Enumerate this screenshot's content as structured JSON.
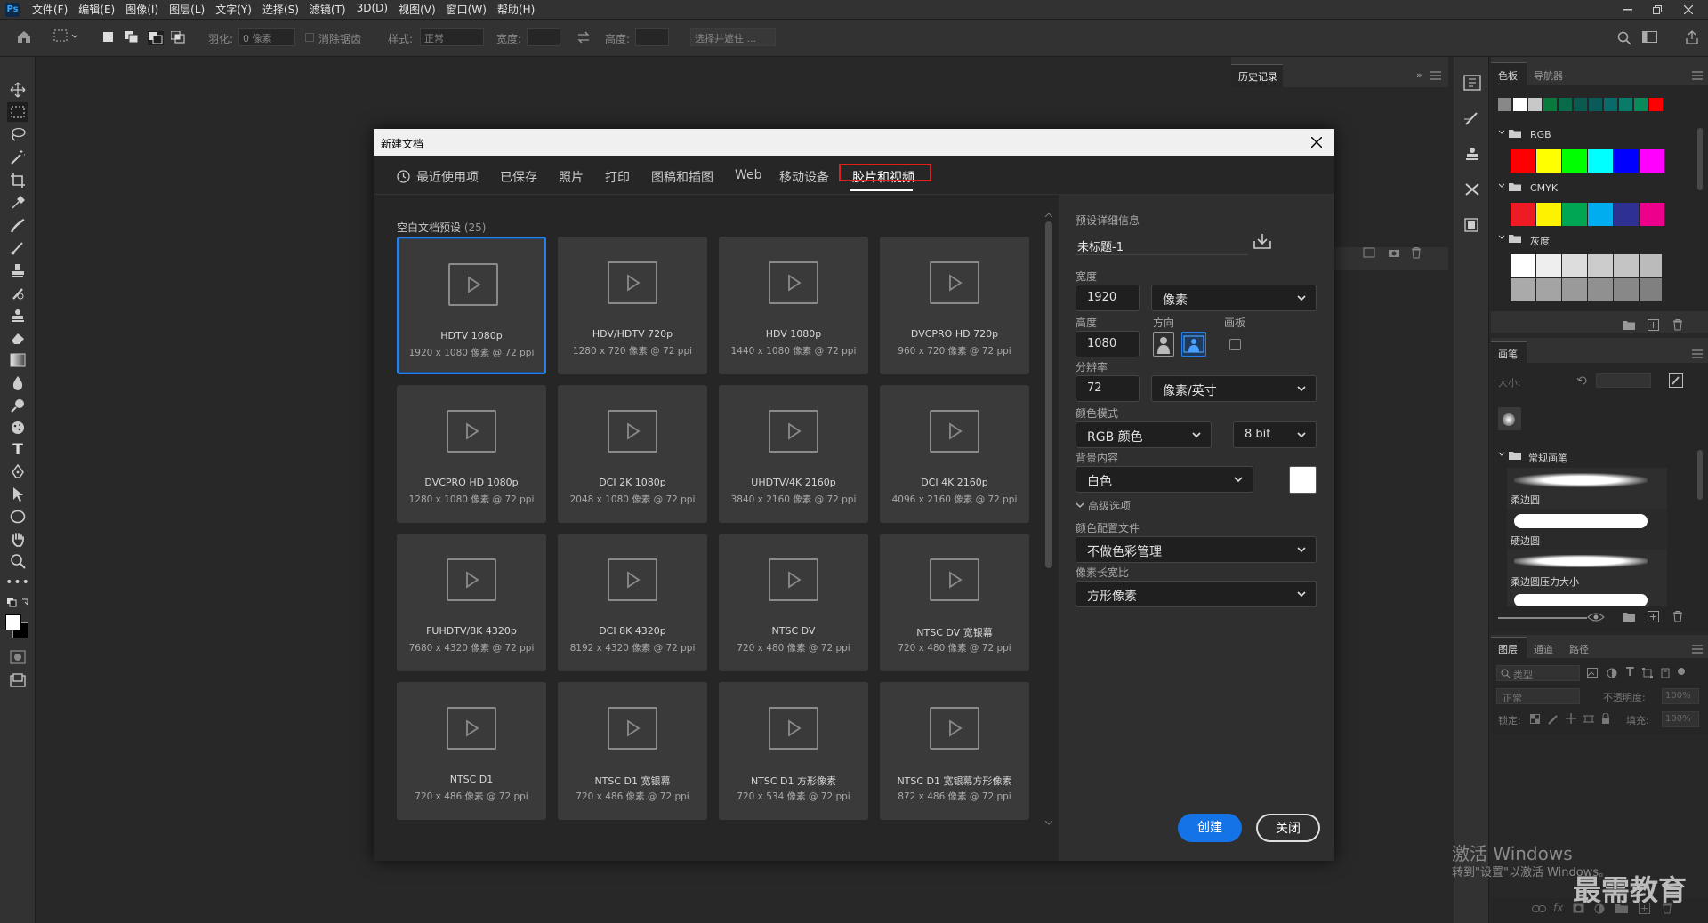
{
  "menu": {
    "app_icon": "Ps",
    "items": [
      "文件(F)",
      "编辑(E)",
      "图像(I)",
      "图层(L)",
      "文字(Y)",
      "选择(S)",
      "滤镜(T)",
      "3D(D)",
      "视图(V)",
      "窗口(W)",
      "帮助(H)"
    ]
  },
  "options": {
    "feather_label": "羽化:",
    "feather_value": "0 像素",
    "antialias_label": "消除锯齿",
    "style_label": "样式:",
    "style_value": "正常",
    "width_label": "宽度:",
    "height_label": "高度:",
    "select_mask_label": "选择并遮住 ..."
  },
  "history_panel": {
    "title": "历史记录"
  },
  "swatches_panel": {
    "tabs": [
      "色板",
      "导航器"
    ],
    "groups": [
      "RGB",
      "CMYK",
      "灰度"
    ],
    "recent_colors": [
      "#888888",
      "#ffffff",
      "#c8c8c8",
      "#0a7a3c",
      "#0a6a4a",
      "#0a5a50",
      "#0a5a5a",
      "#0a6a6a",
      "#0a7a6a",
      "#0a8a5a",
      "#ff0000"
    ],
    "rgb_colors": [
      "#ff0000",
      "#ffff00",
      "#00ff00",
      "#00ffff",
      "#0000ff",
      "#ff00ff"
    ],
    "cmyk_colors": [
      "#ed1c24",
      "#fff200",
      "#00a651",
      "#00aeef",
      "#2e3192",
      "#ec008c"
    ],
    "gray_colors": [
      "#ffffff",
      "#eeeeee",
      "#dddddd",
      "#cccccc",
      "#c4c4c4",
      "#bbbbbb",
      "#aaaaaa",
      "#a4a4a4",
      "#9a9a9a",
      "#909090",
      "#888888",
      "#808080"
    ]
  },
  "brush_panel": {
    "title": "画笔",
    "size_label": "大小:",
    "group": "常规画笔",
    "brushes": [
      "柔边圆",
      "硬边圆",
      "柔边圆压力大小"
    ]
  },
  "layers_panel": {
    "tabs": [
      "图层",
      "通道",
      "路径"
    ],
    "filter_placeholder": "类型",
    "blend_mode": "正常",
    "opacity_label": "不透明度:",
    "opacity_value": "100%",
    "lock_label": "锁定:",
    "fill_label": "填充:",
    "fill_value": "100%"
  },
  "dialog": {
    "title": "新建文档",
    "tabs": [
      "最近使用项",
      "已保存",
      "照片",
      "打印",
      "图稿和插图",
      "Web",
      "移动设备",
      "胶片和视频"
    ],
    "active_tab": 7,
    "presets_header": "空白文档预设",
    "presets_count": "(25)",
    "presets": [
      {
        "name": "HDTV 1080p",
        "size": "1920 x 1080 像素 @ 72 ppi"
      },
      {
        "name": "HDV/HDTV 720p",
        "size": "1280 x 720 像素 @ 72 ppi"
      },
      {
        "name": "HDV 1080p",
        "size": "1440 x 1080 像素 @ 72 ppi"
      },
      {
        "name": "DVCPRO HD 720p",
        "size": "960 x 720 像素 @ 72 ppi"
      },
      {
        "name": "DVCPRO HD 1080p",
        "size": "1280 x 1080 像素 @ 72 ppi"
      },
      {
        "name": "DCI 2K 1080p",
        "size": "2048 x 1080 像素 @ 72 ppi"
      },
      {
        "name": "UHDTV/4K 2160p",
        "size": "3840 x 2160 像素 @ 72 ppi"
      },
      {
        "name": "DCI 4K 2160p",
        "size": "4096 x 2160 像素 @ 72 ppi"
      },
      {
        "name": "FUHDTV/8K 4320p",
        "size": "7680 x 4320 像素 @ 72 ppi"
      },
      {
        "name": "DCI 8K 4320p",
        "size": "8192 x 4320 像素 @ 72 ppi"
      },
      {
        "name": "NTSC DV",
        "size": "720 x 480 像素 @ 72 ppi"
      },
      {
        "name": "NTSC DV 宽银幕",
        "size": "720 x 480 像素 @ 72 ppi"
      },
      {
        "name": "NTSC D1",
        "size": "720 x 486 像素 @ 72 ppi"
      },
      {
        "name": "NTSC D1 宽银幕",
        "size": "720 x 486 像素 @ 72 ppi"
      },
      {
        "name": "NTSC D1 方形像素",
        "size": "720 x 534 像素 @ 72 ppi"
      },
      {
        "name": "NTSC D1 宽银幕方形像素",
        "size": "872 x 486 像素 @ 72 ppi"
      }
    ],
    "details": {
      "header": "预设详细信息",
      "doc_name": "未标题-1",
      "width_label": "宽度",
      "width_value": "1920",
      "width_unit": "像素",
      "height_label": "高度",
      "height_value": "1080",
      "orientation_label": "方向",
      "artboard_label": "画板",
      "resolution_label": "分辨率",
      "resolution_value": "72",
      "resolution_unit": "像素/英寸",
      "color_mode_label": "颜色模式",
      "color_mode_value": "RGB 颜色",
      "bit_depth": "8 bit",
      "bg_label": "背景内容",
      "bg_value": "白色",
      "bg_color": "#ffffff",
      "advanced_label": "高级选项",
      "profile_label": "颜色配置文件",
      "profile_value": "不做色彩管理",
      "aspect_label": "像素长宽比",
      "aspect_value": "方形像素"
    },
    "create_button": "创建",
    "close_button": "关闭"
  },
  "watermark": {
    "activate": "激活 Windows",
    "activate_sub": "转到\"设置\"以激活 Windows。",
    "brand": "最需教育"
  },
  "colors": {
    "accent": "#2680eb",
    "tab_highlight": "#e02020"
  }
}
